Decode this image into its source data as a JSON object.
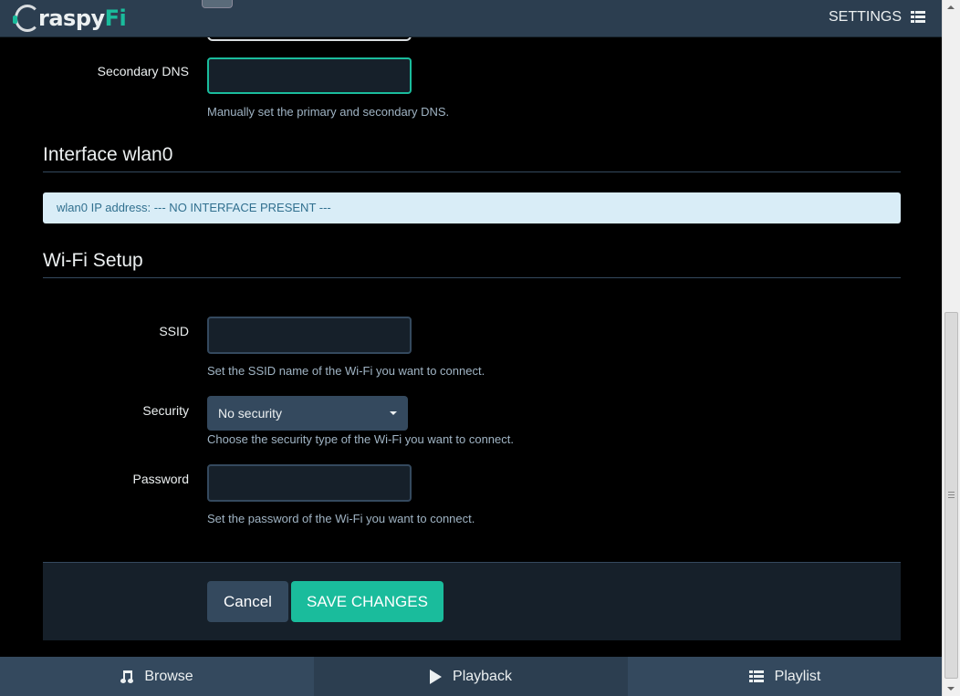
{
  "header": {
    "logo_text": "raspy",
    "logo_accent": "Fi",
    "settings_label": "SETTINGS",
    "settings_icon": "list-icon"
  },
  "dns": {
    "secondary_label": "Secondary DNS",
    "secondary_value": "",
    "help": "Manually set the primary and secondary DNS."
  },
  "interface": {
    "title": "Interface wlan0",
    "alert": "wlan0 IP address: --- NO INTERFACE PRESENT ---"
  },
  "wifi": {
    "title": "Wi-Fi Setup",
    "ssid_label": "SSID",
    "ssid_value": "",
    "ssid_help": "Set the SSID name of the Wi-Fi you want to connect.",
    "security_label": "Security",
    "security_selected": "No security",
    "security_help": "Choose the security type of the Wi-Fi you want to connect.",
    "password_label": "Password",
    "password_value": "",
    "password_help": "Set the password of the Wi-Fi you want to connect."
  },
  "actions": {
    "cancel_label": "Cancel",
    "save_label": "SAVE CHANGES"
  },
  "bottom_nav": {
    "tabs": [
      {
        "label": "Browse",
        "icon": "music-note-icon"
      },
      {
        "label": "Playback",
        "icon": "play-icon"
      },
      {
        "label": "Playlist",
        "icon": "list-icon"
      }
    ],
    "active": "Playback"
  },
  "colors": {
    "accent": "#1abc9c",
    "header": "#2c3e50",
    "panel": "#34495e",
    "alert_bg": "#d9edf7",
    "alert_text": "#31708f"
  }
}
